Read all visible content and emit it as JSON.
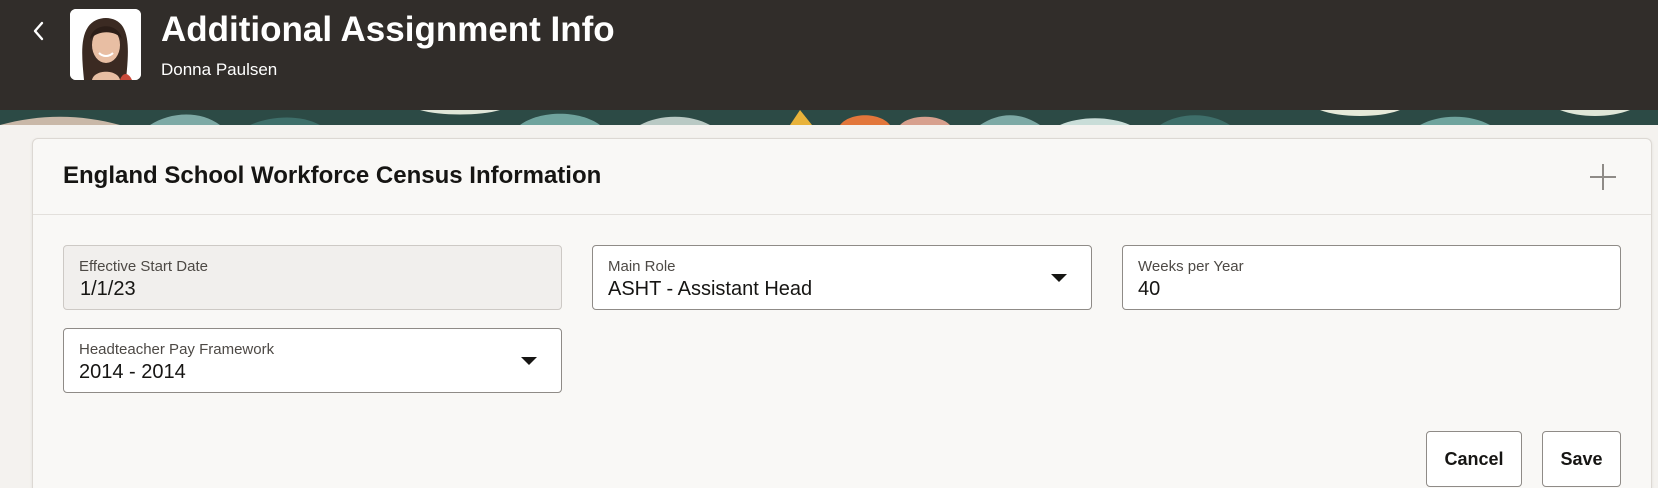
{
  "header": {
    "title": "Additional Assignment Info",
    "person_name": "Donna Paulsen",
    "back_icon": "chevron-left-icon",
    "background_color": "#312d2a"
  },
  "section": {
    "title": "England School Workforce Census Information",
    "add_icon": "plus-icon"
  },
  "fields": {
    "effective_start_date": {
      "label": "Effective Start Date",
      "value": "1/1/23"
    },
    "main_role": {
      "label": "Main Role",
      "value": "ASHT - Assistant Head"
    },
    "weeks_per_year": {
      "label": "Weeks per Year",
      "value": "40"
    },
    "headteacher_pay_framework": {
      "label": "Headteacher Pay Framework",
      "value": "2014 - 2014"
    }
  },
  "actions": {
    "cancel_label": "Cancel",
    "save_label": "Save"
  }
}
